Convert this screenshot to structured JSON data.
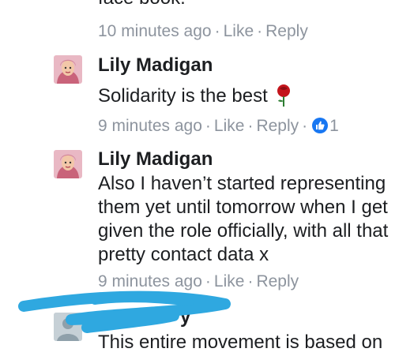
{
  "previous_comment": {
    "text_tail": "face book.",
    "meta": {
      "time": "10 minutes ago",
      "like": "Like",
      "reply": "Reply"
    }
  },
  "comments": [
    {
      "author": "Lily Madigan",
      "text": "Solidarity is the best",
      "emoji": "rose-icon",
      "meta": {
        "time": "9 minutes ago",
        "like": "Like",
        "reply": "Reply",
        "reaction_count": "1"
      }
    },
    {
      "author": "Lily Madigan",
      "text": "Also I haven’t started representing them yet until tomorrow when I get given the role officially, with all that pretty contact data x",
      "meta": {
        "time": "9 minutes ago",
        "like": "Like",
        "reply": "Reply"
      }
    },
    {
      "author_visible": "y",
      "text": "This entire movement is based on",
      "redaction_color": "#2fa8e0"
    }
  ],
  "colors": {
    "meta_gray": "#8d949e",
    "like_blue": "#1877f2",
    "rose_red": "#c4151c"
  },
  "separator": "·"
}
